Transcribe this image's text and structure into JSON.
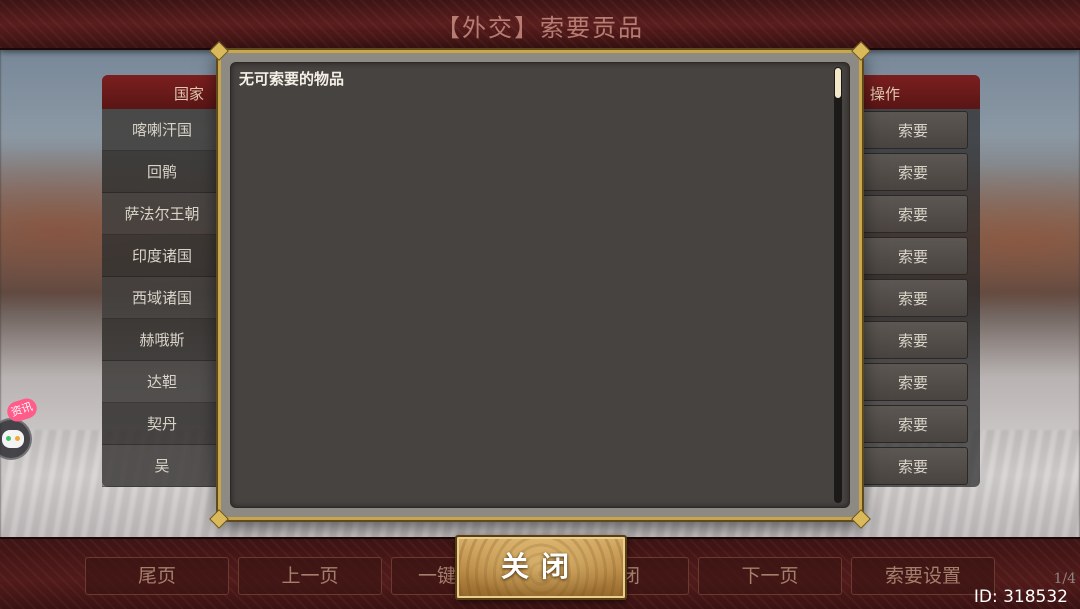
{
  "header": {
    "title": "【外交】索要贡品"
  },
  "table": {
    "col_country": "国家",
    "col_action": "操作",
    "countries": [
      "喀喇汗国",
      "回鹘",
      "萨法尔王朝",
      "印度诸国",
      "西域诸国",
      "赫哦斯",
      "达靼",
      "契丹",
      "吴"
    ],
    "action_label": "索要"
  },
  "dialog": {
    "message": "无可索要的物品",
    "close_label": "关闭"
  },
  "bottom_bar": {
    "buttons": [
      "尾页",
      "上一页",
      "一键",
      "闭",
      "下一页",
      "索要设置"
    ],
    "page_indicator": "1/4"
  },
  "side_widget": {
    "badge": "资讯"
  },
  "watermark": {
    "id": "ID: 318532"
  },
  "colors": {
    "banner_red": "#5a1d1d",
    "frame_gold": "#c9a64c",
    "panel_dark": "#474341"
  }
}
